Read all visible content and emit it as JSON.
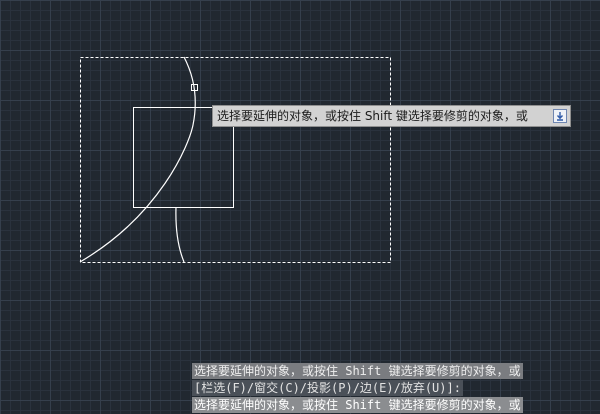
{
  "canvas": {
    "colors": {
      "background": "#212830",
      "grid_minor": "#2a323d",
      "grid_major": "#353f4c",
      "entity": "#ffffff",
      "selection_window": "#ffffff",
      "grip": "#ffffff"
    }
  },
  "tooltip": {
    "prompt": "选择要延伸的对象，或按住 Shift 键选择要修剪的对象，或",
    "button_icon": "down-arrow-icon",
    "background": "#d2d2d2",
    "icon_color": "#2f5aa8"
  },
  "command_line": {
    "history": [
      "选择要延伸的对象，或按住 Shift 键选择要修剪的对象，或",
      "[栏选(F)/窗交(C)/投影(P)/边(E)/放弃(U)]:"
    ],
    "current_prompt": "选择要延伸的对象，或按住 Shift 键选择要修剪的对象，或"
  }
}
